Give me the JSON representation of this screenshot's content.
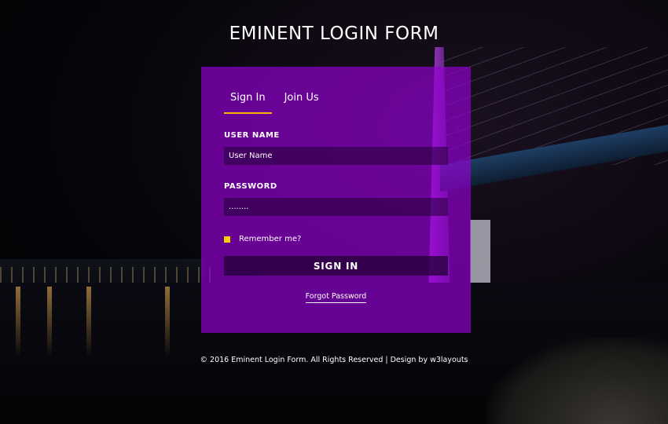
{
  "page": {
    "title": "EMINENT LOGIN FORM"
  },
  "tabs": [
    {
      "label": "Sign In",
      "active": true
    },
    {
      "label": "Join Us",
      "active": false
    }
  ],
  "form": {
    "username_label": "USER NAME",
    "username_value": "User Name",
    "password_label": "PASSWORD",
    "password_value": "........",
    "remember_label": "Remember me?",
    "submit_label": "SIGN IN",
    "forgot_label": "Forgot Password"
  },
  "footer": {
    "text": "© 2016 Eminent Login Form. All Rights Reserved | Design by w3layouts"
  },
  "colors": {
    "panel": "#9400d3",
    "tab_underline": "#ffb300",
    "checkbox": "#ffcc00"
  }
}
